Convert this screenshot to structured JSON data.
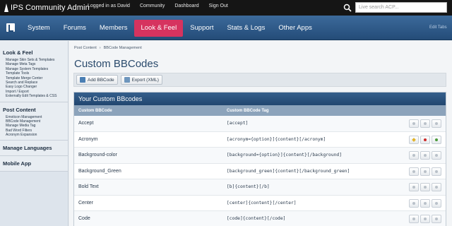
{
  "app": {
    "logo_prefix": "IPS",
    "logo_title": "Community Admin"
  },
  "top_links": [
    "Logged in as David",
    "Community",
    "Dashboard",
    "Sign Out"
  ],
  "search": {
    "placeholder": "Live search ACP..."
  },
  "nav": {
    "tabs": [
      "System",
      "Forums",
      "Members",
      "Look & Feel",
      "Support",
      "Stats & Logs",
      "Other Apps"
    ],
    "active": "Look & Feel",
    "edit_tabs": "Edit Tabs"
  },
  "sidebar": {
    "look_feel": {
      "title": "Look & Feel",
      "items": [
        "Manage Skin Sets & Templates",
        "Manage Meta Tags",
        "Manage System Templates",
        "Template Tools",
        "Template Merge Center",
        "Search and Replace",
        "Easy Logo Changer",
        "Import / Export",
        "Externally Edit Templates & CSS"
      ]
    },
    "post_content": {
      "title": "Post Content",
      "items": [
        "Emoticon Management",
        "BBCode Management",
        "Manage Media Tag",
        "Bad Word Filters",
        "Acronym Expansion"
      ]
    },
    "manage_languages": "Manage Languages",
    "mobile_app": "Mobile App"
  },
  "breadcrumb": [
    "Post Content",
    "BBCode Management"
  ],
  "page_title": "Custom BBCodes",
  "actions": {
    "add": "Add BBCode",
    "export": "Export (XML)"
  },
  "panel": {
    "title": "Your Custom BBcodes",
    "col_name": "Custom BBCode",
    "col_tag": "Custom BBCode Tag",
    "rows": [
      {
        "name": "Accept",
        "tag": "[accept]"
      },
      {
        "name": "Acronym",
        "tag": "[acronym={option}]{content}[/acronym]"
      },
      {
        "name": "Background-color",
        "tag": "[background={option}]{content}[/background]"
      },
      {
        "name": "Background_Green",
        "tag": "[background_green]{content}[/background_green]"
      },
      {
        "name": "Bold Text",
        "tag": "[b]{content}[/b]"
      },
      {
        "name": "Center",
        "tag": "[center]{content}[/center]"
      },
      {
        "name": "Code",
        "tag": "[code]{content}[/code]"
      }
    ]
  },
  "colors": {
    "topbar": "#151515",
    "nav": "#2f5b8a",
    "active_tab": "#d6335f",
    "panel_head": "#2b5280"
  }
}
